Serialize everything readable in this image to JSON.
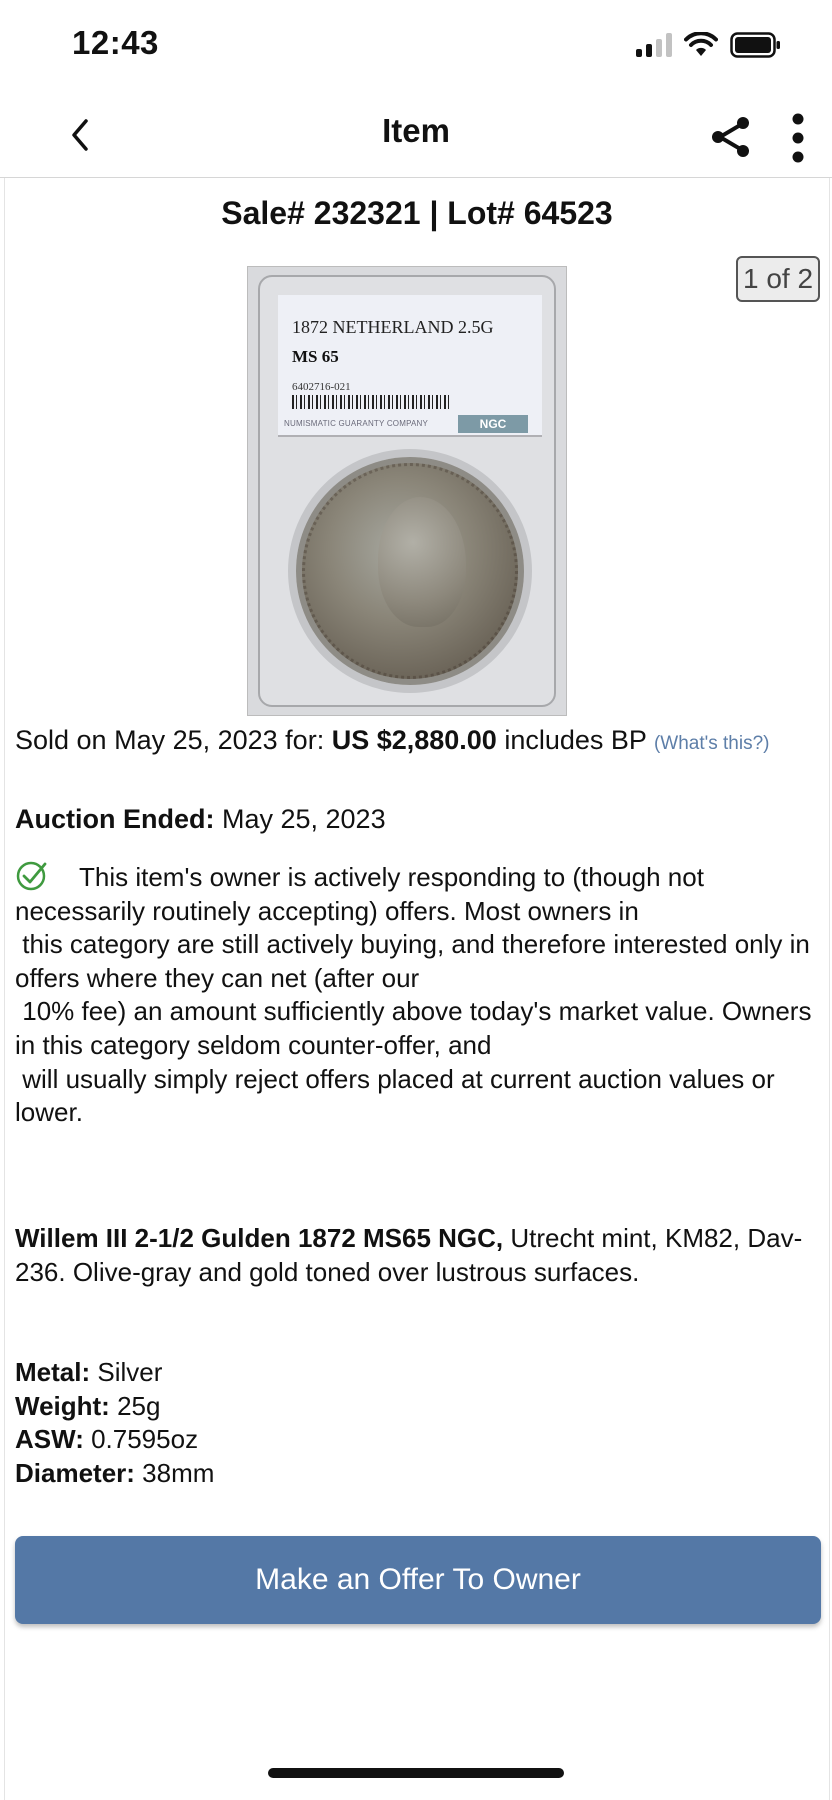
{
  "status_bar": {
    "time": "12:43",
    "signal_icon": "cellular-signal-icon",
    "wifi_icon": "wifi-icon",
    "battery_icon": "battery-icon"
  },
  "nav": {
    "title": "Item",
    "back_icon": "chevron-left-icon",
    "share_icon": "share-icon",
    "more_icon": "more-vertical-icon"
  },
  "item": {
    "sale_title": "Sale# 232321 | Lot# 64523",
    "image_counter": "1 of 2",
    "slab": {
      "label_line1": "1872 NETHERLAND 2.5G",
      "label_grade": "MS 65",
      "label_cert": "6402716-021",
      "label_company": "NUMISMATIC GUARANTY COMPANY",
      "label_logo": "NGC"
    },
    "sold_prefix": "Sold on May 25, 2023 for: ",
    "sold_price": "US $2,880.00",
    "sold_suffix": " includes BP ",
    "whats_this": "(What's this?)",
    "auction_ended_label": "Auction Ended:",
    "auction_ended_value": " May 25, 2023",
    "notice_text": "This item's owner is actively responding to (though not necessarily routinely accepting) offers. Most owners in\n this category are still actively buying, and therefore interested only in offers where they can net (after our\n 10% fee) an amount sufficiently above today's market value. Owners in this category seldom counter-offer, and\n will usually simply reject offers placed at current auction values or lower.",
    "desc_title": "Willem III 2-1/2 Gulden 1872 MS65 NGC,",
    "desc_body": " Utrecht mint, KM82, Dav-236. Olive-gray and gold toned over lustrous surfaces.",
    "specs": [
      {
        "label": "Metal:",
        "value": " Silver"
      },
      {
        "label": "Weight:",
        "value": " 25g"
      },
      {
        "label": "ASW:",
        "value": " 0.7595oz"
      },
      {
        "label": "Diameter:",
        "value": " 38mm"
      }
    ],
    "offer_button": "Make an Offer To Owner"
  },
  "colors": {
    "accent": "#5478a6",
    "link": "#5d7ea8",
    "check": "#3f9a3f"
  }
}
